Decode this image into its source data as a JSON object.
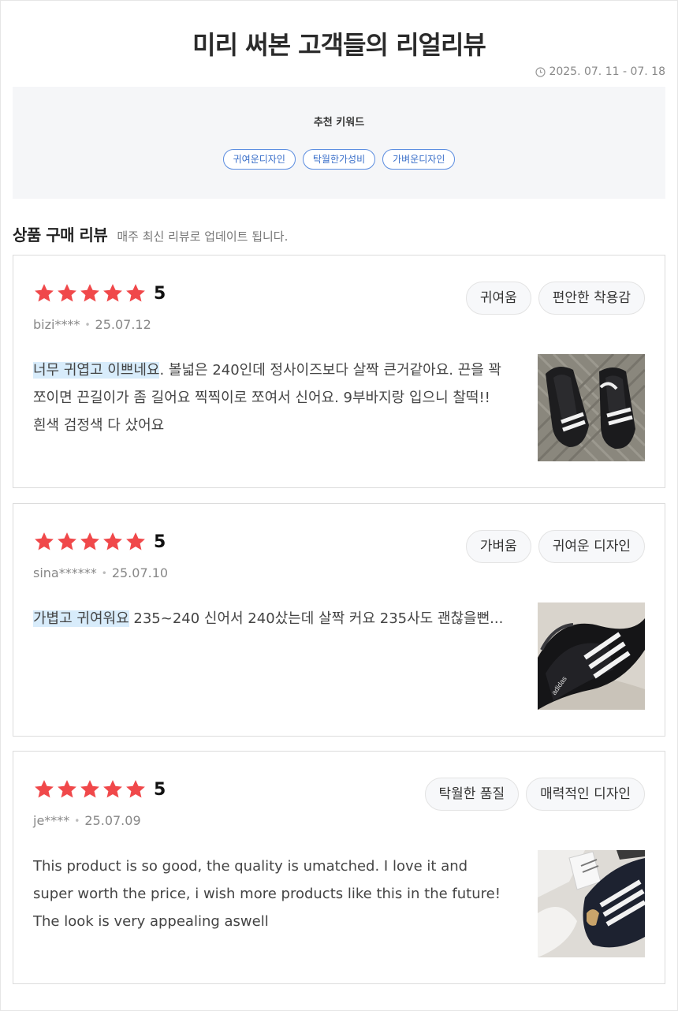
{
  "header": {
    "title": "미리 써본 고객들의 리얼리뷰",
    "period": "2025. 07. 11 - 07. 18"
  },
  "keywords": {
    "title": "추천 키워드",
    "items": [
      "귀여운디자인",
      "탁월한가성비",
      "가벼운디자인"
    ]
  },
  "section": {
    "title": "상품 구매 리뷰",
    "subtitle": "매주 최신 리뷰로 업데이트 됩니다."
  },
  "colors": {
    "star": "#f0484a",
    "highlight": "#d8ecfb",
    "keyword_accent": "#5b8de0"
  },
  "reviews": [
    {
      "rating": "5",
      "stars": 5,
      "user": "bizi****",
      "date": "25.07.12",
      "tags": [
        "귀여움",
        "편안한 착용감"
      ],
      "highlight": "너무 귀엽고 이쁘네요",
      "text": ". 볼넓은 240인데 정사이즈보다 살짝 큰거같아요. 끈을 꽉쪼이면 끈길이가 좀 길어요 찍찍이로 쪼여서 신어요. 9부바지랑 입으니 찰떡!! 흰색 검정색 다 샀어요",
      "image": "black-sneakers-photo"
    },
    {
      "rating": "5",
      "stars": 5,
      "user": "sina******",
      "date": "25.07.10",
      "tags": [
        "가벼움",
        "귀여운 디자인"
      ],
      "highlight": "가볍고 귀여워요",
      "text": " 235~240 신어서 240샀는데 살짝 커요 235사도 괜찮을뻔...",
      "image": "black-sneakers-photo"
    },
    {
      "rating": "5",
      "stars": 5,
      "user": "je****",
      "date": "25.07.09",
      "tags": [
        "탁월한 품질",
        "매력적인 디자인"
      ],
      "highlight": "",
      "text": "This product is so good, the quality is umatched. I love it and super worth the price, i wish more products like this in the future! The look is very appealing aswell",
      "image": "sneaker-in-box-photo"
    }
  ]
}
